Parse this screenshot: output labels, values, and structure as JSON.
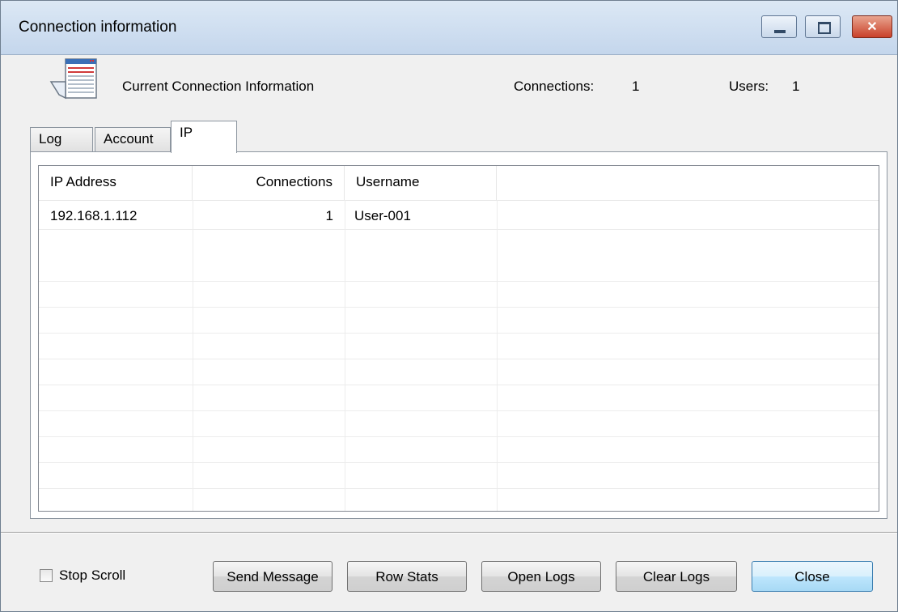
{
  "window": {
    "title": "Connection information"
  },
  "header": {
    "title": "Current Connection Information",
    "connections_label": "Connections:",
    "connections_value": "1",
    "users_label": "Users:",
    "users_value": "1"
  },
  "tabs": [
    {
      "label": "Log"
    },
    {
      "label": "Account"
    },
    {
      "label": "IP"
    }
  ],
  "table": {
    "columns": [
      "IP Address",
      "Connections",
      "Username",
      ""
    ],
    "rows": [
      {
        "ip": "192.168.1.112",
        "connections": "1",
        "username": "User-001"
      }
    ]
  },
  "footer": {
    "stop_scroll_label": "Stop Scroll",
    "buttons": {
      "send_message": "Send Message",
      "row_stats": "Row Stats",
      "open_logs": "Open Logs",
      "clear_logs": "Clear Logs",
      "close": "Close"
    }
  },
  "colors": {
    "titlebar_top": "#dce8f5",
    "titlebar_bottom": "#c4d6ec",
    "close_button": "#c9412a",
    "default_button_border": "#3c7fb1"
  }
}
